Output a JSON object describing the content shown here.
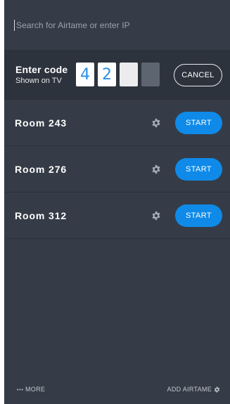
{
  "search": {
    "placeholder": "Search for Airtame or enter IP",
    "value": ""
  },
  "code": {
    "title": "Enter code",
    "subtitle": "Shown on TV",
    "digits": [
      "4",
      "2",
      "",
      ""
    ],
    "cancel_label": "CANCEL"
  },
  "rooms": [
    {
      "name": "Room 243",
      "start_label": "START"
    },
    {
      "name": "Room 276",
      "start_label": "START"
    },
    {
      "name": "Room 312",
      "start_label": "START"
    }
  ],
  "footer": {
    "more_label": "MORE",
    "more_icon": "ellipsis-icon",
    "add_label": "ADD AIRTAME",
    "add_icon": "gear-icon"
  },
  "colors": {
    "background": "#353c47",
    "accent": "#0f8ae8"
  }
}
